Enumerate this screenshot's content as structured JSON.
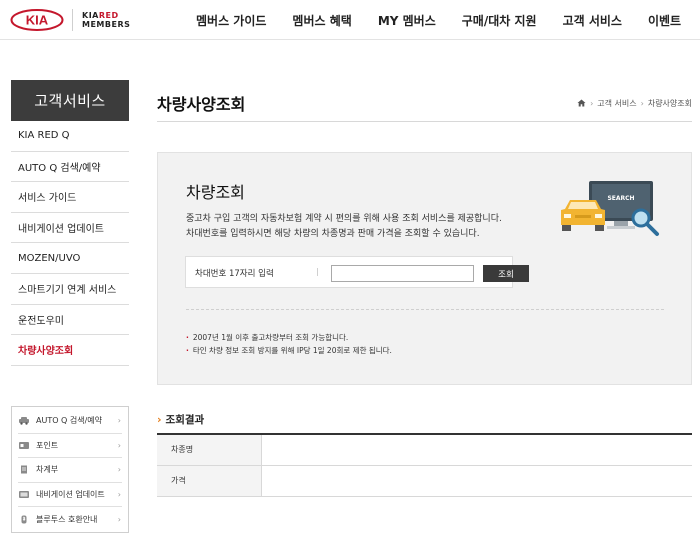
{
  "header": {
    "brand": "KIA",
    "members_logo_line1_a": "KIA",
    "members_logo_line1_b": "RED",
    "members_logo_line2": "MEMBERS",
    "nav": [
      "멤버스 가이드",
      "멤버스 혜택",
      "MY 멤버스",
      "구매/대차 지원",
      "고객 서비스",
      "이벤트"
    ]
  },
  "sidebar": {
    "title": "고객서비스",
    "items": [
      {
        "label": "KIA RED Q"
      },
      {
        "label": "AUTO Q 검색/예약"
      },
      {
        "label": "서비스 가이드"
      },
      {
        "label": "내비게이션 업데이트"
      },
      {
        "label": "MOZEN/UVO"
      },
      {
        "label": "스마트기기 연계 서비스"
      },
      {
        "label": "운전도우미"
      },
      {
        "label": "차량사양조회",
        "active": true
      }
    ],
    "quick": [
      {
        "label": "AUTO Q 검색/예약",
        "icon": "car-icon"
      },
      {
        "label": "포인트",
        "icon": "point-icon"
      },
      {
        "label": "차계부",
        "icon": "ledger-icon"
      },
      {
        "label": "내비게이션 업데이트",
        "icon": "navigation-icon"
      },
      {
        "label": "블루투스 호환안내",
        "icon": "bluetooth-icon"
      }
    ]
  },
  "main": {
    "page_title": "차량사양조회",
    "breadcrumb": [
      "고객 서비스",
      "차량사양조회"
    ],
    "panel": {
      "title": "차량조회",
      "desc_line1": "중고차 구입 고객의 자동차보험 계약 시 편의를 위해 사용 조회 서비스를 제공합니다.",
      "desc_line2": "차대번호를 입력하시면 해당 차량의 차종명과 판매 가격을 조회할 수 있습니다.",
      "search_label": "차대번호 17자리 입력",
      "search_sep": "|",
      "search_value": "",
      "search_button": "조회",
      "illus_text": "SEARCH",
      "notes": [
        "2007년 1월 이후 출고차량부터 조회 가능합니다.",
        "타인 차량 정보 조회 방지를 위해 IP당 1일 20회로 제한 됩니다."
      ]
    },
    "result": {
      "title": "조회결과",
      "rows": [
        {
          "label": "차종명",
          "value": ""
        },
        {
          "label": "가격",
          "value": ""
        }
      ]
    }
  },
  "colors": {
    "accent_red": "#c4172c",
    "sidebar_dark": "#3c3c3c",
    "chevron_orange": "#e47e1c",
    "car_yellow": "#f2b431"
  }
}
